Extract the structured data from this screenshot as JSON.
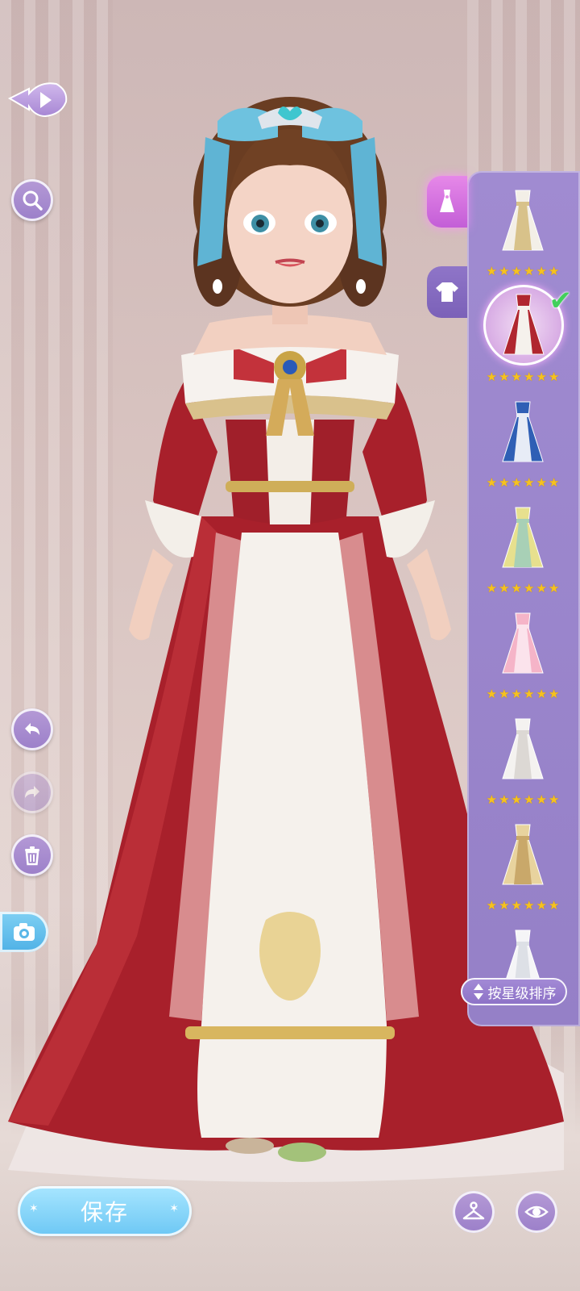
{
  "left_toolbar": {
    "back": "back-icon",
    "search": "search-icon",
    "undo": "undo-icon",
    "redo": "redo-icon",
    "delete": "trash-icon",
    "camera": "camera-icon"
  },
  "category_tabs": [
    {
      "name": "dress-tab",
      "icon": "dress-icon",
      "active": true
    },
    {
      "name": "top-tab",
      "icon": "shirt-icon",
      "active": false
    }
  ],
  "outfits": [
    {
      "name": "white-gold-gown",
      "stars": 6,
      "selected": false,
      "colors": [
        "#f3efe7",
        "#d8c28a"
      ]
    },
    {
      "name": "red-white-gown",
      "stars": 6,
      "selected": true,
      "colors": [
        "#b0262f",
        "#f5f1ec"
      ]
    },
    {
      "name": "blue-gown",
      "stars": 6,
      "selected": false,
      "colors": [
        "#2f5fb5",
        "#e7ecf6"
      ]
    },
    {
      "name": "green-yellow-hanfu",
      "stars": 6,
      "selected": false,
      "colors": [
        "#e7e08e",
        "#a8d0b6"
      ]
    },
    {
      "name": "pink-gown",
      "stars": 6,
      "selected": false,
      "colors": [
        "#f5b4c8",
        "#fbe3ec"
      ]
    },
    {
      "name": "white-wedding-gown",
      "stars": 6,
      "selected": false,
      "colors": [
        "#f4f2f0",
        "#dcd8d4"
      ]
    },
    {
      "name": "gold-hanfu",
      "stars": 6,
      "selected": false,
      "colors": [
        "#e8d39e",
        "#c9a86a"
      ]
    },
    {
      "name": "white-feather-gown",
      "stars": 0,
      "selected": false,
      "colors": [
        "#f5f5f7",
        "#dde0e6"
      ]
    }
  ],
  "sort_button": {
    "label": "按星级排序",
    "icon": "sort-arrows-icon"
  },
  "save_button": {
    "label": "保存"
  },
  "bottom_right": {
    "outfit": "hanger-icon",
    "view": "eye-icon"
  },
  "colors": {
    "panel": "#9a85cc",
    "accent_pink": "#d46be0",
    "save_blue": "#6cc7f4",
    "star": "#f6c21f",
    "check": "#43d05b"
  }
}
